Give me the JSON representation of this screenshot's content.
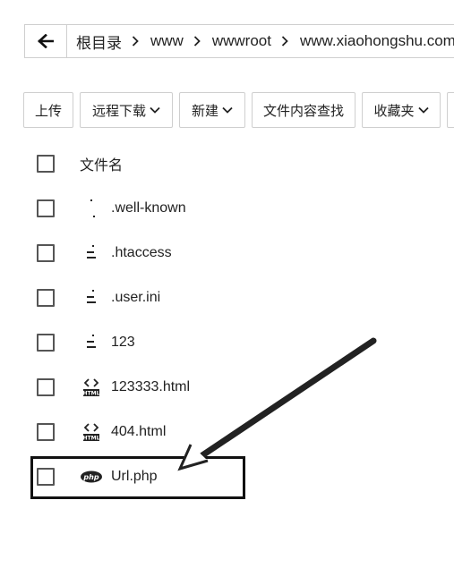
{
  "breadcrumb": {
    "back_icon": "arrow-left-icon",
    "items": [
      "根目录",
      "www",
      "wwwroot",
      "www.xiaohongshu.com.c"
    ]
  },
  "toolbar": {
    "upload": "上传",
    "remote_download": "远程下载",
    "new": "新建",
    "content_search": "文件内容查找",
    "favorites": "收藏夹"
  },
  "file_list": {
    "header": "文件名",
    "files": [
      {
        "name": ".well-known",
        "icon": "generic-file-icon"
      },
      {
        "name": ".htaccess",
        "icon": "text-file-icon"
      },
      {
        "name": ".user.ini",
        "icon": "text-file-icon"
      },
      {
        "name": "123",
        "icon": "text-file-icon"
      },
      {
        "name": "123333.html",
        "icon": "html-file-icon",
        "icon_label": "HTML"
      },
      {
        "name": "404.html",
        "icon": "html-file-icon",
        "icon_label": "HTML"
      },
      {
        "name": "Url.php",
        "icon": "php-file-icon",
        "icon_label": "php"
      }
    ]
  },
  "annotation": {
    "highlight_color": "#111111",
    "arrow_color": "#222222",
    "target": "Url.php"
  }
}
